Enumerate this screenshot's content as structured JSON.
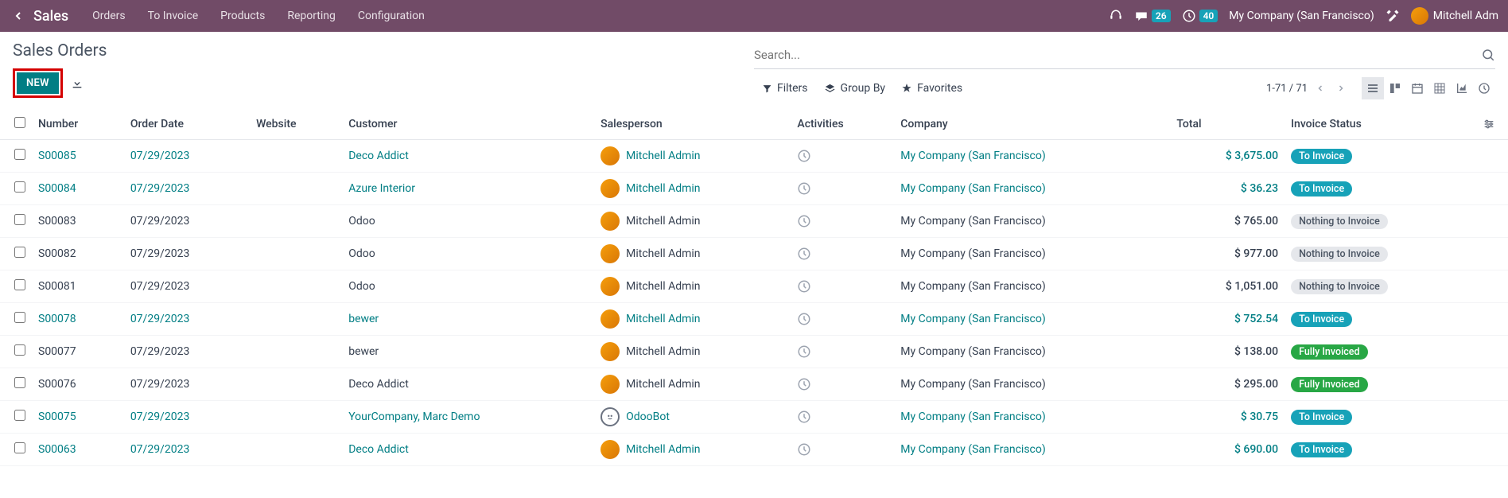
{
  "nav": {
    "app": "Sales",
    "menu": [
      "Orders",
      "To Invoice",
      "Products",
      "Reporting",
      "Configuration"
    ],
    "messages_count": "26",
    "activities_count": "40",
    "company": "My Company (San Francisco)",
    "user": "Mitchell Adm"
  },
  "header": {
    "title": "Sales Orders",
    "new_label": "NEW",
    "search_placeholder": "Search...",
    "filters_label": "Filters",
    "groupby_label": "Group By",
    "favorites_label": "Favorites",
    "pager": "1-71 / 71"
  },
  "columns": {
    "number": "Number",
    "order_date": "Order Date",
    "website": "Website",
    "customer": "Customer",
    "salesperson": "Salesperson",
    "activities": "Activities",
    "company": "Company",
    "total": "Total",
    "invoice_status": "Invoice Status"
  },
  "rows": [
    {
      "number": "S00085",
      "date": "07/29/2023",
      "customer": "Deco Addict",
      "salesperson": "Mitchell Admin",
      "company": "My Company (San Francisco)",
      "total": "$ 3,675.00",
      "status": "To Invoice",
      "status_class": "to-invoice",
      "link": true,
      "bot": false
    },
    {
      "number": "S00084",
      "date": "07/29/2023",
      "customer": "Azure Interior",
      "salesperson": "Mitchell Admin",
      "company": "My Company (San Francisco)",
      "total": "$ 36.23",
      "status": "To Invoice",
      "status_class": "to-invoice",
      "link": true,
      "bot": false
    },
    {
      "number": "S00083",
      "date": "07/29/2023",
      "customer": "Odoo",
      "salesperson": "Mitchell Admin",
      "company": "My Company (San Francisco)",
      "total": "$ 765.00",
      "status": "Nothing to Invoice",
      "status_class": "nothing",
      "link": false,
      "bot": false
    },
    {
      "number": "S00082",
      "date": "07/29/2023",
      "customer": "Odoo",
      "salesperson": "Mitchell Admin",
      "company": "My Company (San Francisco)",
      "total": "$ 977.00",
      "status": "Nothing to Invoice",
      "status_class": "nothing",
      "link": false,
      "bot": false
    },
    {
      "number": "S00081",
      "date": "07/29/2023",
      "customer": "Odoo",
      "salesperson": "Mitchell Admin",
      "company": "My Company (San Francisco)",
      "total": "$ 1,051.00",
      "status": "Nothing to Invoice",
      "status_class": "nothing",
      "link": false,
      "bot": false
    },
    {
      "number": "S00078",
      "date": "07/29/2023",
      "customer": "bewer",
      "salesperson": "Mitchell Admin",
      "company": "My Company (San Francisco)",
      "total": "$ 752.54",
      "status": "To Invoice",
      "status_class": "to-invoice",
      "link": true,
      "bot": false
    },
    {
      "number": "S00077",
      "date": "07/29/2023",
      "customer": "bewer",
      "salesperson": "Mitchell Admin",
      "company": "My Company (San Francisco)",
      "total": "$ 138.00",
      "status": "Fully Invoiced",
      "status_class": "fully",
      "link": false,
      "bot": false
    },
    {
      "number": "S00076",
      "date": "07/29/2023",
      "customer": "Deco Addict",
      "salesperson": "Mitchell Admin",
      "company": "My Company (San Francisco)",
      "total": "$ 295.00",
      "status": "Fully Invoiced",
      "status_class": "fully",
      "link": false,
      "bot": false
    },
    {
      "number": "S00075",
      "date": "07/29/2023",
      "customer": "YourCompany, Marc Demo",
      "salesperson": "OdooBot",
      "company": "My Company (San Francisco)",
      "total": "$ 30.75",
      "status": "To Invoice",
      "status_class": "to-invoice",
      "link": true,
      "bot": true
    },
    {
      "number": "S00063",
      "date": "07/29/2023",
      "customer": "Deco Addict",
      "salesperson": "Mitchell Admin",
      "company": "My Company (San Francisco)",
      "total": "$ 690.00",
      "status": "To Invoice",
      "status_class": "to-invoice",
      "link": true,
      "bot": false
    }
  ]
}
